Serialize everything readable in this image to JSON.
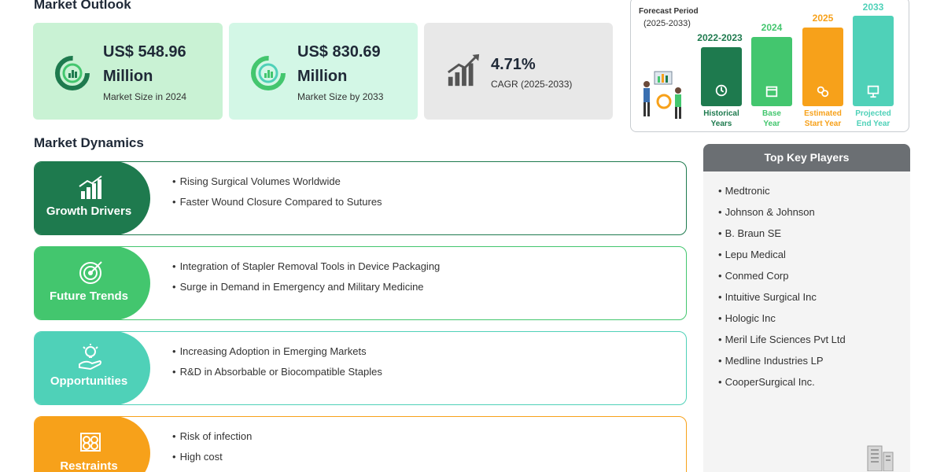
{
  "outlook": {
    "title": "Market Outlook",
    "cards": [
      {
        "value_line1": "US$ 548.96",
        "value_line2": "Million",
        "caption": "Market Size in 2024",
        "icon": "pie-chart-icon",
        "color": "#c9f2d4"
      },
      {
        "value_line1": "US$ 830.69",
        "value_line2": "Million",
        "caption": "Market Size by 2033",
        "icon": "pie-chart-icon",
        "color": "#d3f7e6"
      },
      {
        "value_line1": "4.71%",
        "caption": "CAGR (2025-2033)",
        "icon": "growth-chart-icon",
        "color": "#e8e8e8"
      }
    ]
  },
  "forecast": {
    "title": "Forecast Period",
    "subtitle": "(2025-2033)",
    "columns": [
      {
        "year": "2022-2023",
        "caption_1": "Historical",
        "caption_2": "Years",
        "color": "#1e7a4e",
        "icon": "history-icon"
      },
      {
        "year": "2024",
        "caption_1": "Base",
        "caption_2": "Year",
        "color": "#43c66e",
        "icon": "calendar-icon"
      },
      {
        "year": "2025",
        "caption_1": "Estimated",
        "caption_2": "Start Year",
        "color": "#f7a11a",
        "icon": "coins-icon"
      },
      {
        "year": "2033",
        "caption_1": "Projected",
        "caption_2": "End Year",
        "color": "#4fd1b8",
        "icon": "presentation-icon"
      }
    ]
  },
  "dynamics": {
    "title": "Market Dynamics",
    "rows": [
      {
        "label": "Growth Drivers",
        "color": "#1e7a4e",
        "icon": "bar-growth-icon",
        "items": [
          "Rising Surgical Volumes Worldwide",
          "Faster Wound Closure Compared to Sutures"
        ]
      },
      {
        "label": "Future Trends",
        "color": "#43c66e",
        "icon": "target-icon",
        "items": [
          "Integration of Stapler Removal Tools in Device Packaging",
          "Surge in Demand in Emergency and Military Medicine"
        ]
      },
      {
        "label": "Opportunities",
        "color": "#4fd1b8",
        "icon": "lightbulb-hand-icon",
        "items": [
          "Increasing Adoption in Emerging Markets",
          "R&D in Absorbable or Biocompatible Staples"
        ]
      },
      {
        "label": "Restraints",
        "color": "#f7a11a",
        "icon": "barrier-icon",
        "items": [
          "Risk of infection",
          "High cost"
        ]
      }
    ]
  },
  "players": {
    "title": "Top Key Players",
    "items": [
      "Medtronic",
      "Johnson & Johnson",
      "B. Braun SE",
      "Lepu Medical",
      "Conmed Corp",
      "Intuitive Surgical Inc",
      "Hologic Inc",
      "Meril Life Sciences Pvt Ltd",
      "Medline Industries LP",
      "CooperSurgical Inc."
    ]
  }
}
